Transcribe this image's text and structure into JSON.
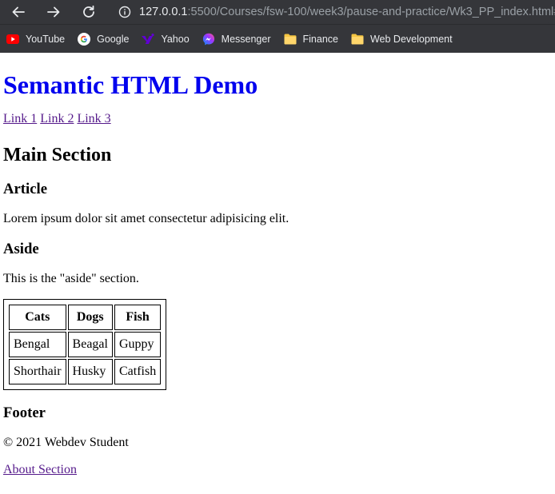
{
  "browser": {
    "url_host": "127.0.0.1",
    "url_rest": ":5500/Courses/fsw-100/week3/pause-and-practice/Wk3_PP_index.html#",
    "nav_icons": [
      "back-arrow-icon",
      "forward-arrow-icon",
      "reload-icon"
    ],
    "bookmarks": [
      {
        "label": "YouTube",
        "icon": "youtube-icon",
        "color": "#ff0000"
      },
      {
        "label": "Google",
        "icon": "google-icon",
        "color": "#4285f4"
      },
      {
        "label": "Yahoo",
        "icon": "yahoo-icon",
        "color": "#6001d2"
      },
      {
        "label": "Messenger",
        "icon": "messenger-icon",
        "color": "#a033ff"
      },
      {
        "label": "Finance",
        "icon": "folder-icon",
        "color": "#f5c542"
      },
      {
        "label": "Web Development",
        "icon": "folder-icon",
        "color": "#f5c542"
      }
    ]
  },
  "page": {
    "title": "Semantic HTML Demo",
    "nav_links": [
      "Link 1",
      "Link 2",
      "Link 3"
    ],
    "main_heading": "Main Section",
    "article_heading": "Article",
    "article_text": "Lorem ipsum dolor sit amet consectetur adipisicing elit.",
    "aside_heading": "Aside",
    "aside_text": "This is the \"aside\" section.",
    "table": {
      "headers": [
        "Cats",
        "Dogs",
        "Fish"
      ],
      "rows": [
        [
          "Bengal",
          "Beagal",
          "Guppy"
        ],
        [
          "Shorthair",
          "Husky",
          "Catfish"
        ]
      ]
    },
    "footer_heading": "Footer",
    "footer_text": "© 2021 Webdev Student",
    "about_link": "About Section"
  },
  "colors": {
    "chrome_bg": "#35363a",
    "heading_link": "#0000ee",
    "visited_link": "#551a8b"
  }
}
